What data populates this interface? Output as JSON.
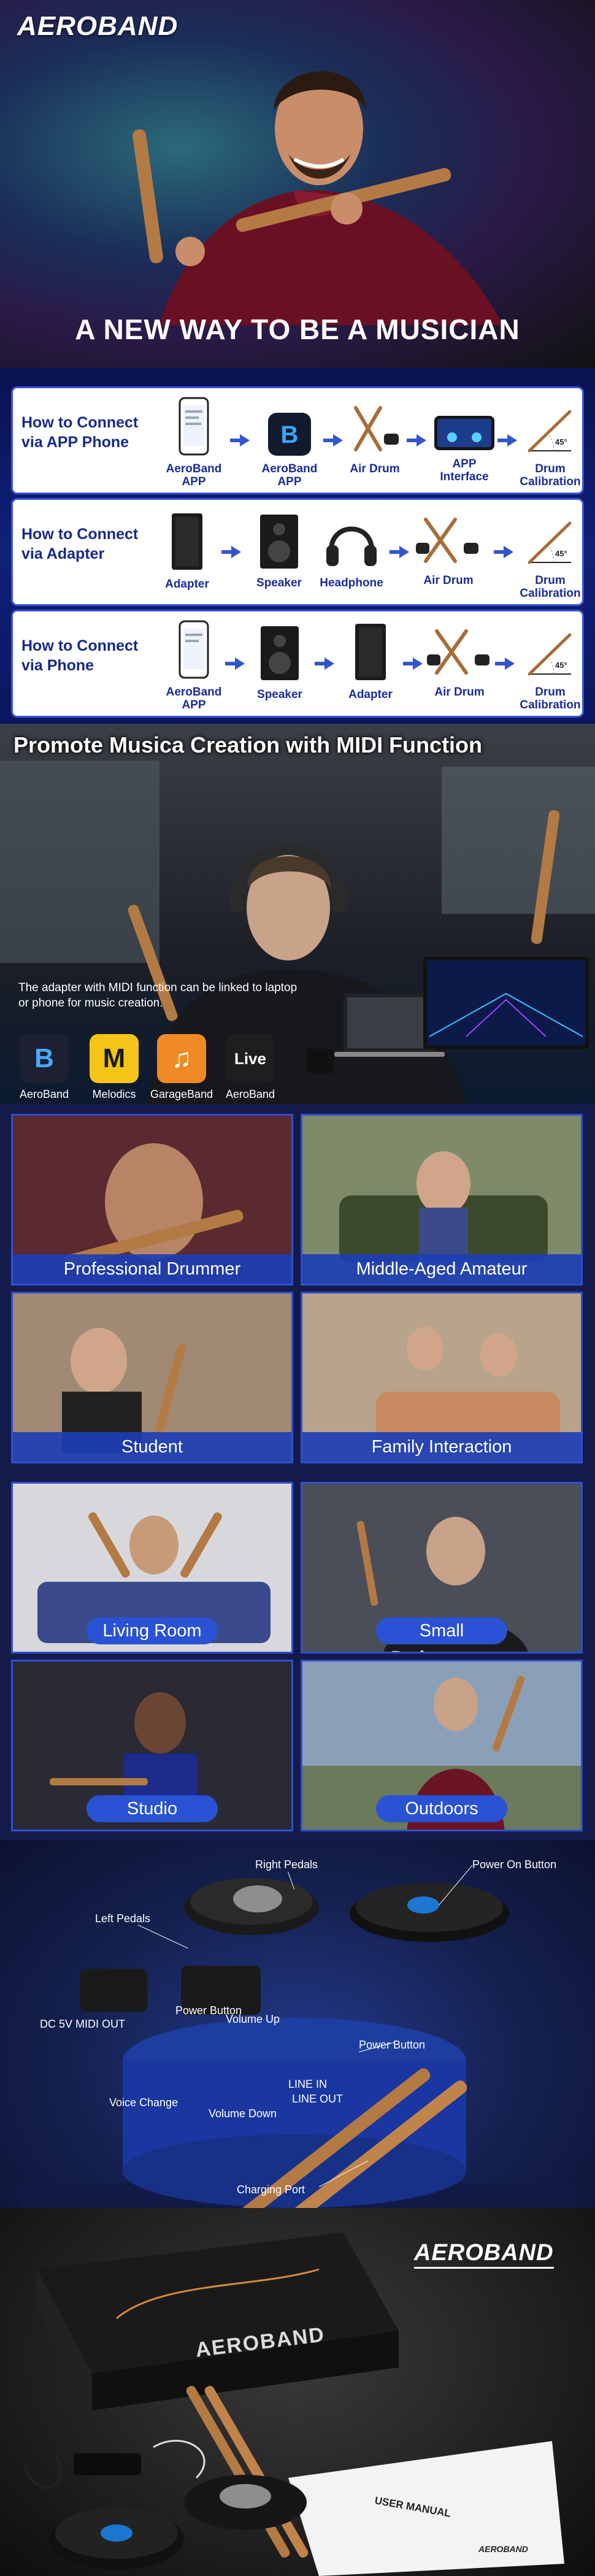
{
  "brand": "AEROBAND",
  "hero": {
    "headline": "A NEW WAY TO BE A MUSICIAN"
  },
  "connect": [
    {
      "title": "How to Connect via APP Phone",
      "steps": [
        "AeroBand APP",
        "AeroBand APP",
        "Air Drum",
        "APP Interface",
        "Drum Calibration"
      ]
    },
    {
      "title": "How to Connect via Adapter",
      "steps": [
        "Adapter",
        "Speaker",
        "Headphone",
        "Air Drum",
        "Drum Calibration"
      ]
    },
    {
      "title": "How to Connect via Phone",
      "steps": [
        "AeroBand APP",
        "Speaker",
        "Adapter",
        "Air Drum",
        "Drum Calibration"
      ]
    }
  ],
  "calibration_angle": "45°",
  "midi": {
    "title": "Promote Musica Creation with MIDI Function",
    "caption": "The adapter with MIDI function can be linked to laptop or phone for music creation.",
    "apps": [
      {
        "label": "AeroBand",
        "glyph": "B",
        "color": "#1d2030",
        "fg": "#4aa8ff"
      },
      {
        "label": "Melodics",
        "glyph": "M",
        "color": "#f4c418",
        "fg": "#1a1a1a"
      },
      {
        "label": "GarageBand",
        "glyph": "♫",
        "color": "#f08a24",
        "fg": "#ffffff"
      },
      {
        "label": "AeroBand",
        "glyph": "Live",
        "color": "#1e1e1e",
        "fg": "#ffffff"
      }
    ]
  },
  "scenes1": [
    "Professional Drummer",
    "Middle-Aged Amateur",
    "Student",
    "Family Interaction"
  ],
  "scenes2": [
    "Living Room",
    "Small Performance",
    "Studio",
    "Outdoors"
  ],
  "parts": {
    "left_pedals": "Left Pedals",
    "right_pedals": "Right Pedals",
    "power_on_button": "Power On Button",
    "dc_midi": "DC 5V MIDI OUT",
    "power_button": "Power Button",
    "volume_up": "Volume Up",
    "power_button_stick": "Power Button",
    "line_in": "LINE IN",
    "line_out": "LINE OUT",
    "voice_change": "Voice Change",
    "volume_down": "Volume Down",
    "charging_port": "Charging Port"
  },
  "package": {
    "box_brand": "AEROBAND",
    "manual": "USER MANUAL",
    "manual_brand": "AEROBAND"
  }
}
